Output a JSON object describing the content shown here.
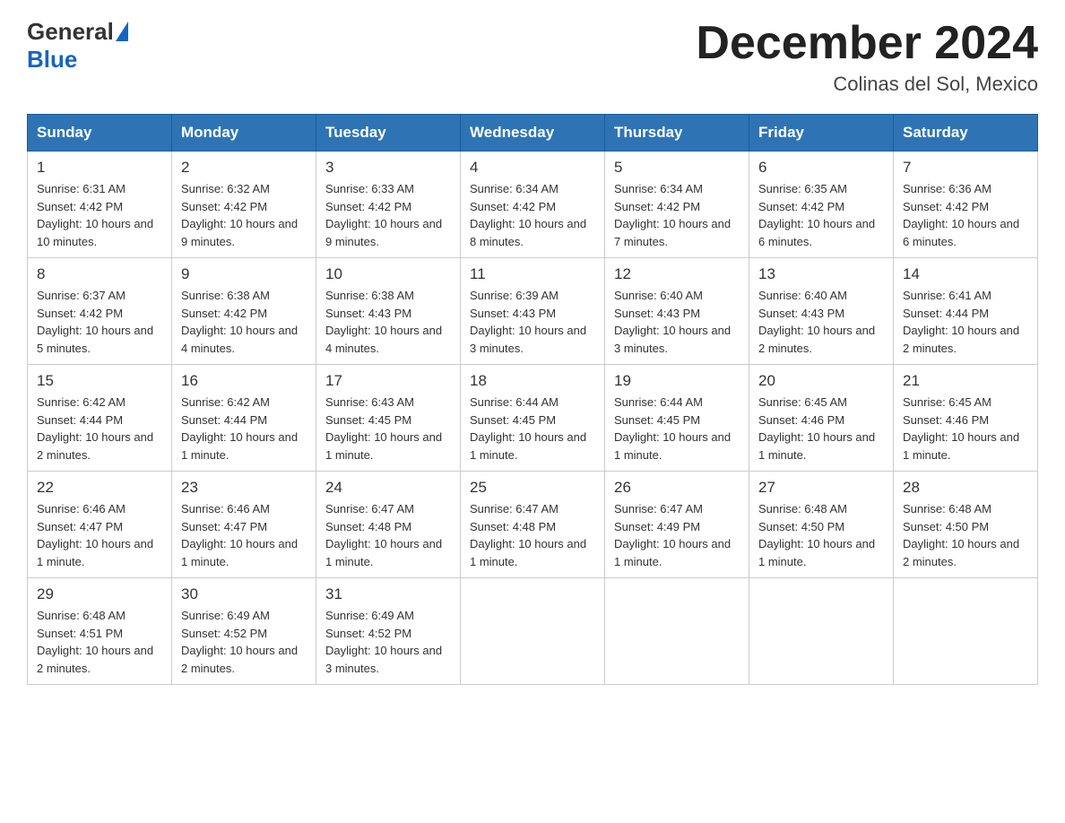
{
  "logo": {
    "text_general": "General",
    "text_blue": "Blue"
  },
  "title": "December 2024",
  "subtitle": "Colinas del Sol, Mexico",
  "headers": [
    "Sunday",
    "Monday",
    "Tuesday",
    "Wednesday",
    "Thursday",
    "Friday",
    "Saturday"
  ],
  "weeks": [
    [
      {
        "day": "1",
        "sunrise": "6:31 AM",
        "sunset": "4:42 PM",
        "daylight": "10 hours and 10 minutes."
      },
      {
        "day": "2",
        "sunrise": "6:32 AM",
        "sunset": "4:42 PM",
        "daylight": "10 hours and 9 minutes."
      },
      {
        "day": "3",
        "sunrise": "6:33 AM",
        "sunset": "4:42 PM",
        "daylight": "10 hours and 9 minutes."
      },
      {
        "day": "4",
        "sunrise": "6:34 AM",
        "sunset": "4:42 PM",
        "daylight": "10 hours and 8 minutes."
      },
      {
        "day": "5",
        "sunrise": "6:34 AM",
        "sunset": "4:42 PM",
        "daylight": "10 hours and 7 minutes."
      },
      {
        "day": "6",
        "sunrise": "6:35 AM",
        "sunset": "4:42 PM",
        "daylight": "10 hours and 6 minutes."
      },
      {
        "day": "7",
        "sunrise": "6:36 AM",
        "sunset": "4:42 PM",
        "daylight": "10 hours and 6 minutes."
      }
    ],
    [
      {
        "day": "8",
        "sunrise": "6:37 AM",
        "sunset": "4:42 PM",
        "daylight": "10 hours and 5 minutes."
      },
      {
        "day": "9",
        "sunrise": "6:38 AM",
        "sunset": "4:42 PM",
        "daylight": "10 hours and 4 minutes."
      },
      {
        "day": "10",
        "sunrise": "6:38 AM",
        "sunset": "4:43 PM",
        "daylight": "10 hours and 4 minutes."
      },
      {
        "day": "11",
        "sunrise": "6:39 AM",
        "sunset": "4:43 PM",
        "daylight": "10 hours and 3 minutes."
      },
      {
        "day": "12",
        "sunrise": "6:40 AM",
        "sunset": "4:43 PM",
        "daylight": "10 hours and 3 minutes."
      },
      {
        "day": "13",
        "sunrise": "6:40 AM",
        "sunset": "4:43 PM",
        "daylight": "10 hours and 2 minutes."
      },
      {
        "day": "14",
        "sunrise": "6:41 AM",
        "sunset": "4:44 PM",
        "daylight": "10 hours and 2 minutes."
      }
    ],
    [
      {
        "day": "15",
        "sunrise": "6:42 AM",
        "sunset": "4:44 PM",
        "daylight": "10 hours and 2 minutes."
      },
      {
        "day": "16",
        "sunrise": "6:42 AM",
        "sunset": "4:44 PM",
        "daylight": "10 hours and 1 minute."
      },
      {
        "day": "17",
        "sunrise": "6:43 AM",
        "sunset": "4:45 PM",
        "daylight": "10 hours and 1 minute."
      },
      {
        "day": "18",
        "sunrise": "6:44 AM",
        "sunset": "4:45 PM",
        "daylight": "10 hours and 1 minute."
      },
      {
        "day": "19",
        "sunrise": "6:44 AM",
        "sunset": "4:45 PM",
        "daylight": "10 hours and 1 minute."
      },
      {
        "day": "20",
        "sunrise": "6:45 AM",
        "sunset": "4:46 PM",
        "daylight": "10 hours and 1 minute."
      },
      {
        "day": "21",
        "sunrise": "6:45 AM",
        "sunset": "4:46 PM",
        "daylight": "10 hours and 1 minute."
      }
    ],
    [
      {
        "day": "22",
        "sunrise": "6:46 AM",
        "sunset": "4:47 PM",
        "daylight": "10 hours and 1 minute."
      },
      {
        "day": "23",
        "sunrise": "6:46 AM",
        "sunset": "4:47 PM",
        "daylight": "10 hours and 1 minute."
      },
      {
        "day": "24",
        "sunrise": "6:47 AM",
        "sunset": "4:48 PM",
        "daylight": "10 hours and 1 minute."
      },
      {
        "day": "25",
        "sunrise": "6:47 AM",
        "sunset": "4:48 PM",
        "daylight": "10 hours and 1 minute."
      },
      {
        "day": "26",
        "sunrise": "6:47 AM",
        "sunset": "4:49 PM",
        "daylight": "10 hours and 1 minute."
      },
      {
        "day": "27",
        "sunrise": "6:48 AM",
        "sunset": "4:50 PM",
        "daylight": "10 hours and 1 minute."
      },
      {
        "day": "28",
        "sunrise": "6:48 AM",
        "sunset": "4:50 PM",
        "daylight": "10 hours and 2 minutes."
      }
    ],
    [
      {
        "day": "29",
        "sunrise": "6:48 AM",
        "sunset": "4:51 PM",
        "daylight": "10 hours and 2 minutes."
      },
      {
        "day": "30",
        "sunrise": "6:49 AM",
        "sunset": "4:52 PM",
        "daylight": "10 hours and 2 minutes."
      },
      {
        "day": "31",
        "sunrise": "6:49 AM",
        "sunset": "4:52 PM",
        "daylight": "10 hours and 3 minutes."
      },
      null,
      null,
      null,
      null
    ]
  ]
}
